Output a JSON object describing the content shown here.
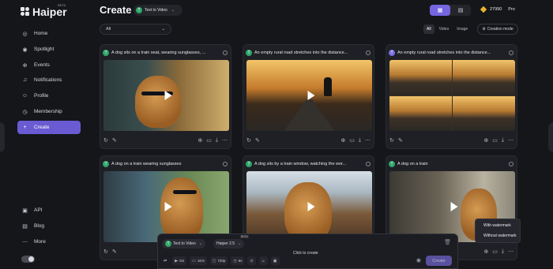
{
  "app": {
    "name": "Haiper",
    "beta": "BETA"
  },
  "sidebar": {
    "items": [
      {
        "label": "Home",
        "icon": "home-icon"
      },
      {
        "label": "Spotlight",
        "icon": "spotlight-icon"
      },
      {
        "label": "Events",
        "icon": "events-icon"
      },
      {
        "label": "Notifications",
        "icon": "bell-icon"
      },
      {
        "label": "Profile",
        "icon": "profile-icon"
      },
      {
        "label": "Membership",
        "icon": "membership-icon"
      },
      {
        "label": "Create",
        "icon": "plus-icon",
        "active": true
      }
    ],
    "bottom": [
      {
        "label": "API",
        "icon": "api-icon"
      },
      {
        "label": "Blog",
        "icon": "blog-icon"
      },
      {
        "label": "More",
        "icon": "more-icon"
      }
    ]
  },
  "header": {
    "title": "Create",
    "mode": "Text to Video",
    "credits": "27990",
    "plan": "Pro",
    "filter": "All",
    "segments": [
      "All",
      "Video",
      "Image"
    ],
    "creation_mode": "Creation mode"
  },
  "cards": [
    {
      "title": "A dog sits on a train seat, wearing sunglasses,  ..."
    },
    {
      "title": "An empty rural road stretches into the distance..."
    },
    {
      "title": "An empty rural road stretches into the distance..."
    },
    {
      "title": "A dog on a train wearing sunglasses"
    },
    {
      "title": "A dog sits by a train window, watching the wor..."
    },
    {
      "title": "A dog on a train"
    }
  ],
  "download_menu": {
    "with": "With watermark",
    "without": "Without watermark"
  },
  "composer": {
    "mode": "Text to Video",
    "model": "Haiper 2.5",
    "model_tag": "BETA",
    "hint": "Click to create",
    "options": [
      "On",
      "16:9",
      "720p",
      "6s"
    ],
    "create": "Create"
  },
  "colors": {
    "accent": "#6a5bd2",
    "background": "#15161a",
    "card": "#1f2025",
    "gem": "#e8b32a"
  }
}
